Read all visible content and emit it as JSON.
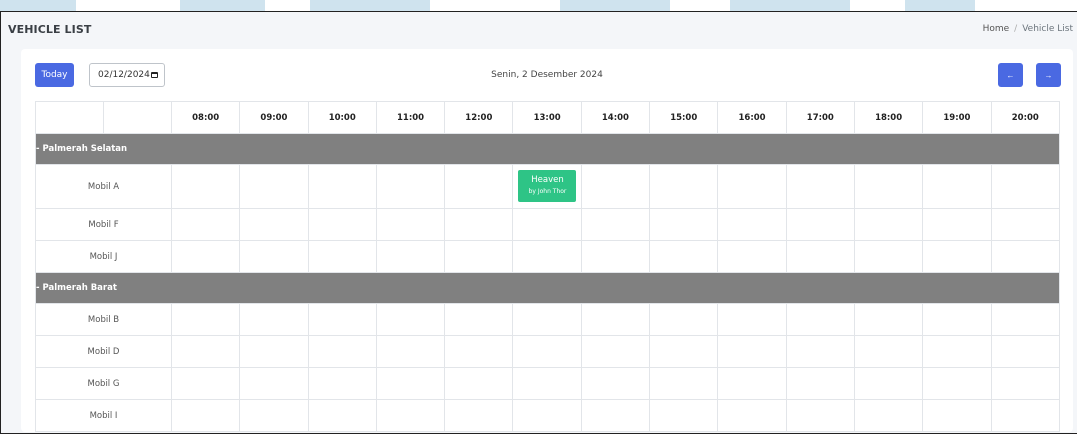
{
  "header": {
    "title": "VEHICLE LIST",
    "breadcrumb": [
      "Home",
      "Vehicle List"
    ]
  },
  "toolbar": {
    "today_label": "Today",
    "date_value": "02/12/2024",
    "date_display": "Senin, 2 Desember 2024",
    "prev_label": "←",
    "next_label": "→"
  },
  "schedule": {
    "hours": [
      "08:00",
      "09:00",
      "10:00",
      "11:00",
      "12:00",
      "13:00",
      "14:00",
      "15:00",
      "16:00",
      "17:00",
      "18:00",
      "19:00",
      "20:00"
    ],
    "groups": [
      {
        "name": "- Palmerah Selatan",
        "vehicles": [
          "Mobil A",
          "Mobil F",
          "Mobil J"
        ]
      },
      {
        "name": "- Palmerah Barat",
        "vehicles": [
          "Mobil B",
          "Mobil D",
          "Mobil G",
          "Mobil I"
        ]
      }
    ],
    "bookings": [
      {
        "vehicle": "Mobil A",
        "hour": "13:00",
        "title": "Heaven",
        "by": "by John Thor"
      }
    ]
  },
  "colors": {
    "primary": "#4a69e2",
    "group_bg": "#808080",
    "booking": "#2ec486"
  }
}
